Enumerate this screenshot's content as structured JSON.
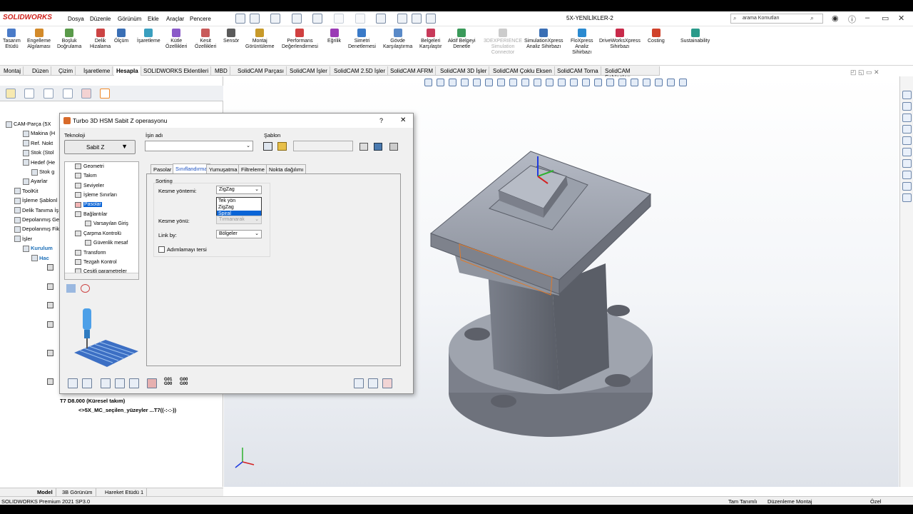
{
  "app": {
    "logo": "SOLIDWORKS",
    "document_title": "5X-YENİLİKLER-2",
    "menus": [
      "Dosya",
      "Düzenle",
      "Görünüm",
      "Ekle",
      "Araçlar",
      "Pencere"
    ],
    "search_placeholder": "arama Komutları"
  },
  "ribbon": [
    {
      "label": "Tasarım\nEtüdü",
      "color": "#4a7bc8"
    },
    {
      "label": "Engelleme\nAlgılaması",
      "color": "#d38a2a"
    },
    {
      "label": "Boşluk\nDoğrulama",
      "color": "#5a9a4a"
    },
    {
      "label": "Delik\nHizalama",
      "color": "#c44"
    },
    {
      "label": "Ölçüm",
      "color": "#3a6fb5"
    },
    {
      "label": "İşaretleme",
      "color": "#3a9fbf"
    },
    {
      "label": "Kütle\nÖzellikleri",
      "color": "#8a5ac8"
    },
    {
      "label": "Kesit\nÖzellikleri",
      "color": "#c85a5a"
    },
    {
      "label": "Sensör",
      "color": "#5a5a5a"
    },
    {
      "label": "Montaj\nGörüntüleme",
      "color": "#c89a2a"
    },
    {
      "label": "Performans\nDeğerlendirmesi",
      "color": "#d04040"
    },
    {
      "label": "Eğrilik",
      "color": "#9a3ab5"
    },
    {
      "label": "Simetri\nDenetlemesi",
      "color": "#3a7ac8"
    },
    {
      "label": "Gövde\nKarşılaştırma",
      "color": "#5a8ac8"
    },
    {
      "label": "Belgeleri\nKarşılaştır",
      "color": "#c83a5a"
    },
    {
      "label": "Aktif Belgeyi\nDenetle",
      "color": "#3a9a5a"
    },
    {
      "label": "3DEXPERIENCE\nSimulation\nConnector",
      "color": "#cccccc",
      "dim": true
    },
    {
      "label": "SimulationXpress\nAnaliz Sihirbazı",
      "color": "#3a6fb5"
    },
    {
      "label": "FloXpress\nAnaliz\nSihirbazı",
      "color": "#2a8ad0"
    },
    {
      "label": "DriveWorksXpress\nSihirbazı",
      "color": "#c82a4a"
    },
    {
      "label": "Costing",
      "color": "#d0412a"
    },
    {
      "label": "Sustainability",
      "color": "#2a9a8a"
    }
  ],
  "command_tabs": [
    "Montaj",
    "Düzen",
    "Çizim",
    "İşaretleme",
    "Hesapla",
    "SOLIDWORKS Eklentileri",
    "MBD",
    "SolidCAM Parçası",
    "SolidCAM İşler",
    "SolidCAM 2.5D İşler",
    "SolidCAM AFRM",
    "SolidCAM 3D İşler",
    "SolidCAM Çoklu Eksen",
    "SolidCAM Torna",
    "SolidCAM Şablonları"
  ],
  "active_command_tab": "Hesapla",
  "tree": [
    {
      "label": "CAM-Parça (5X",
      "indent": 0,
      "bold": false
    },
    {
      "label": "Makina (H",
      "indent": 2,
      "bold": false
    },
    {
      "label": "Ref. Nokt",
      "indent": 2,
      "bold": false
    },
    {
      "label": "Stok (Stol",
      "indent": 2,
      "bold": false
    },
    {
      "label": "Hedef (He",
      "indent": 2,
      "bold": false
    },
    {
      "label": "Stok g",
      "indent": 3,
      "bold": false
    },
    {
      "label": "Ayarlar",
      "indent": 2,
      "bold": false
    },
    {
      "label": "ToolKit",
      "indent": 1,
      "bold": false
    },
    {
      "label": "İşleme Şablonl",
      "indent": 1,
      "bold": false
    },
    {
      "label": "Delik Tanıma İş",
      "indent": 1,
      "bold": false
    },
    {
      "label": "Depolanmış Ge",
      "indent": 1,
      "bold": false
    },
    {
      "label": "Depolanmış Fik",
      "indent": 1,
      "bold": false
    },
    {
      "label": "İşler",
      "indent": 1,
      "bold": false
    },
    {
      "label": "Kurulum",
      "indent": 2,
      "bold": true,
      "color": "#1c6fb8"
    },
    {
      "label": "Hac",
      "indent": 3,
      "bold": true,
      "color": "#1c6fb8"
    }
  ],
  "tree_bottom": [
    {
      "label": "T7 D8.000  (Küresel takım)",
      "bold": true
    },
    {
      "label": "<>5X_MC_seçilen_yüzeyler ...T7((-:-:-))",
      "bold": true
    }
  ],
  "dialog": {
    "title": "Turbo 3D HSM Sabit Z operasyonu",
    "help": "?",
    "close": "✕",
    "technology_label": "Teknoloji",
    "technology_value": "Sabit Z",
    "job_name_label": "İşin adı",
    "job_name_value": "",
    "template_label": "Şablon",
    "nav_items": [
      {
        "label": "Geometri",
        "indent": 0
      },
      {
        "label": "Takım",
        "indent": 0
      },
      {
        "label": "Seviyeler",
        "indent": 0
      },
      {
        "label": "İşleme Sınırları",
        "indent": 0
      },
      {
        "label": "Pasolar",
        "indent": 0,
        "selected": true
      },
      {
        "label": "Bağlantılar",
        "indent": 0
      },
      {
        "label": "Varsayılan Giriş",
        "indent": 1
      },
      {
        "label": "Çarpma Kontrolü",
        "indent": 0
      },
      {
        "label": "Güvenlik mesaf",
        "indent": 1
      },
      {
        "label": "Transform",
        "indent": 0
      },
      {
        "label": "Tezgah Kontrol",
        "indent": 0
      },
      {
        "label": "Çeşitli parametreler",
        "indent": 0
      }
    ],
    "tabs": [
      "Pasolar",
      "Sınıflandırma",
      "Yumuşatma",
      "Filtreleme",
      "Nokta dağılımı"
    ],
    "active_tab": "Sınıflandırma",
    "group_title": "Sorting",
    "cut_method_label": "Kesme yöntemi:",
    "cut_method_value": "ZigZag",
    "cut_method_options": [
      "Tek yön",
      "ZigZag",
      "Spiral"
    ],
    "cut_method_highlight": "Spiral",
    "cut_direction_label": "Kesme yönü:",
    "cut_direction_value": "Tırmanarak",
    "link_by_label": "Link by:",
    "link_by_value": "Bölgeler",
    "reverse_step_label": "Adımlamayı tersi",
    "gcode_btn_1": "G01\nG00",
    "gcode_btn_2": "G00\nG00"
  },
  "model_tabs": [
    "Model",
    "3B Görünüm",
    "Hareket Etüdü 1"
  ],
  "status": {
    "left": "SOLIDWORKS Premium 2021 SP3.0",
    "defined": "Tam Tanımlı",
    "mode": "Düzenleme Montaj",
    "custom": "Özel"
  },
  "colors": {
    "accent": "#0a64d6",
    "part": "#a3a8b4",
    "part_dark": "#6d717c",
    "edge_highlight": "#e07a2a"
  }
}
